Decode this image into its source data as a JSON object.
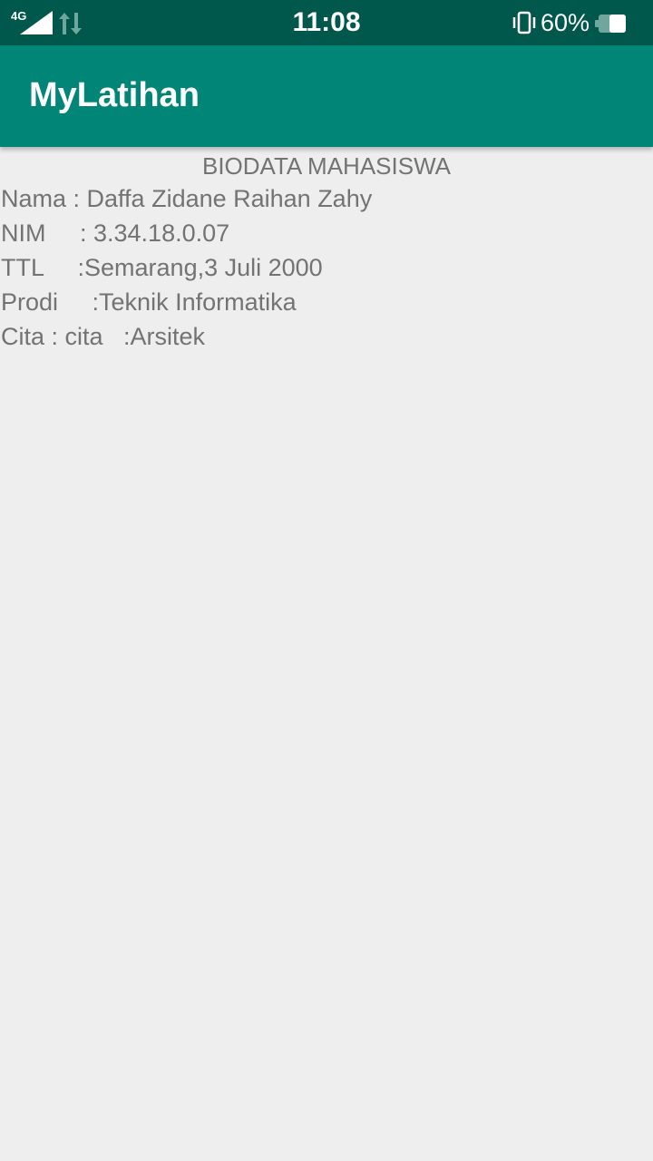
{
  "status_bar": {
    "network": "4G",
    "time": "11:08",
    "battery": "60%",
    "icons": [
      "signal-icon",
      "data-transfer-icon",
      "vibrate-icon",
      "battery-icon"
    ]
  },
  "app_bar": {
    "title": "MyLatihan",
    "color": "#008577"
  },
  "content": {
    "heading": "BIODATA MAHASISWA",
    "lines": [
      "Nama : Daffa Zidane Raihan Zahy",
      "NIM     : 3.34.18.0.07",
      "TTL     :Semarang,3 Juli 2000",
      "Prodi     :Teknik Informatika",
      "Cita : cita   :Arsitek"
    ]
  }
}
